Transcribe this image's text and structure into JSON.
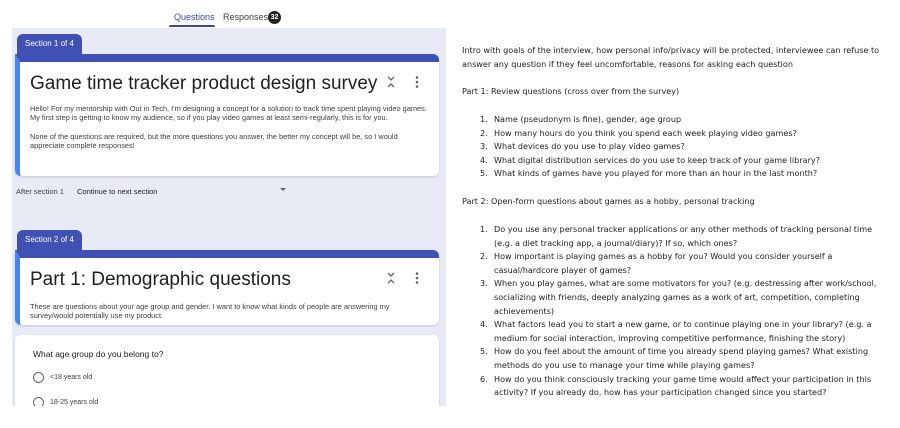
{
  "tabs": {
    "questions": "Questions",
    "responses": "Responses",
    "responses_count": "32"
  },
  "section1": {
    "tag": "Section 1 of 4",
    "title": "Game time tracker product design survey",
    "description": "Hello! For my mentorship with Out in Tech, I'm designing a concept for a solution to track time spent playing video games. My first step is getting to know my audience, so if you play video games at least semi-regularly, this is for you.\n\nNone of the questions are required, but the more questions you answer, the better my concept will be, so I would appreciate complete responses!",
    "after_label": "After section 1",
    "after_value": "Continue to next section"
  },
  "section2": {
    "tag": "Section 2 of 4",
    "title": "Part 1: Demographic questions",
    "description": "These are questions about your age group and gender. I want to know what kinds of people are answering my survey/would potentially use my product."
  },
  "question1": {
    "text": "What age group do you belong to?",
    "options": [
      "<18 years old",
      "18-25 years old"
    ]
  },
  "doc": {
    "intro": "Intro with goals of the interview, how personal info/privacy will be protected, interviewee can refuse to answer any question if they feel uncomfortable, reasons for asking each question",
    "part1_heading": "Part 1: Review questions (cross over from the survey)",
    "part1_items": [
      "Name (pseudonym is fine), gender, age group",
      "How many hours do you think you spend each week playing video games?",
      "What devices do you use to play video games?",
      "What digital distribution services do you use to keep track of your game library?",
      "What kinds of games have you played for more than an hour in the last month?"
    ],
    "part2_heading": "Part 2: Open-form questions about games as a hobby, personal tracking",
    "part2_items": [
      "Do you use any personal tracker applications or any other methods of tracking personal time (e.g. a diet tracking app, a journal/diary)? If so, which ones?",
      "How important is playing games as a hobby for you? Would you consider yourself a casual/hardcore player of games?",
      "When you play games, what are some motivators for you? (e.g. destressing after work/school, socializing with friends, deeply analyzing games as a work of art, competition, completing achievements)",
      "What factors lead you to start a new game, or to continue playing one in your library? (e.g. a medium for social interaction, improving competitive performance, finishing the story)",
      "How do you feel about the amount of time you already spend playing games? What existing methods do you use to manage your time while playing games?",
      "How do you think consciously tracking your game time would affect your participation in this activity? If you already do, how has your participation changed since you started?"
    ]
  }
}
